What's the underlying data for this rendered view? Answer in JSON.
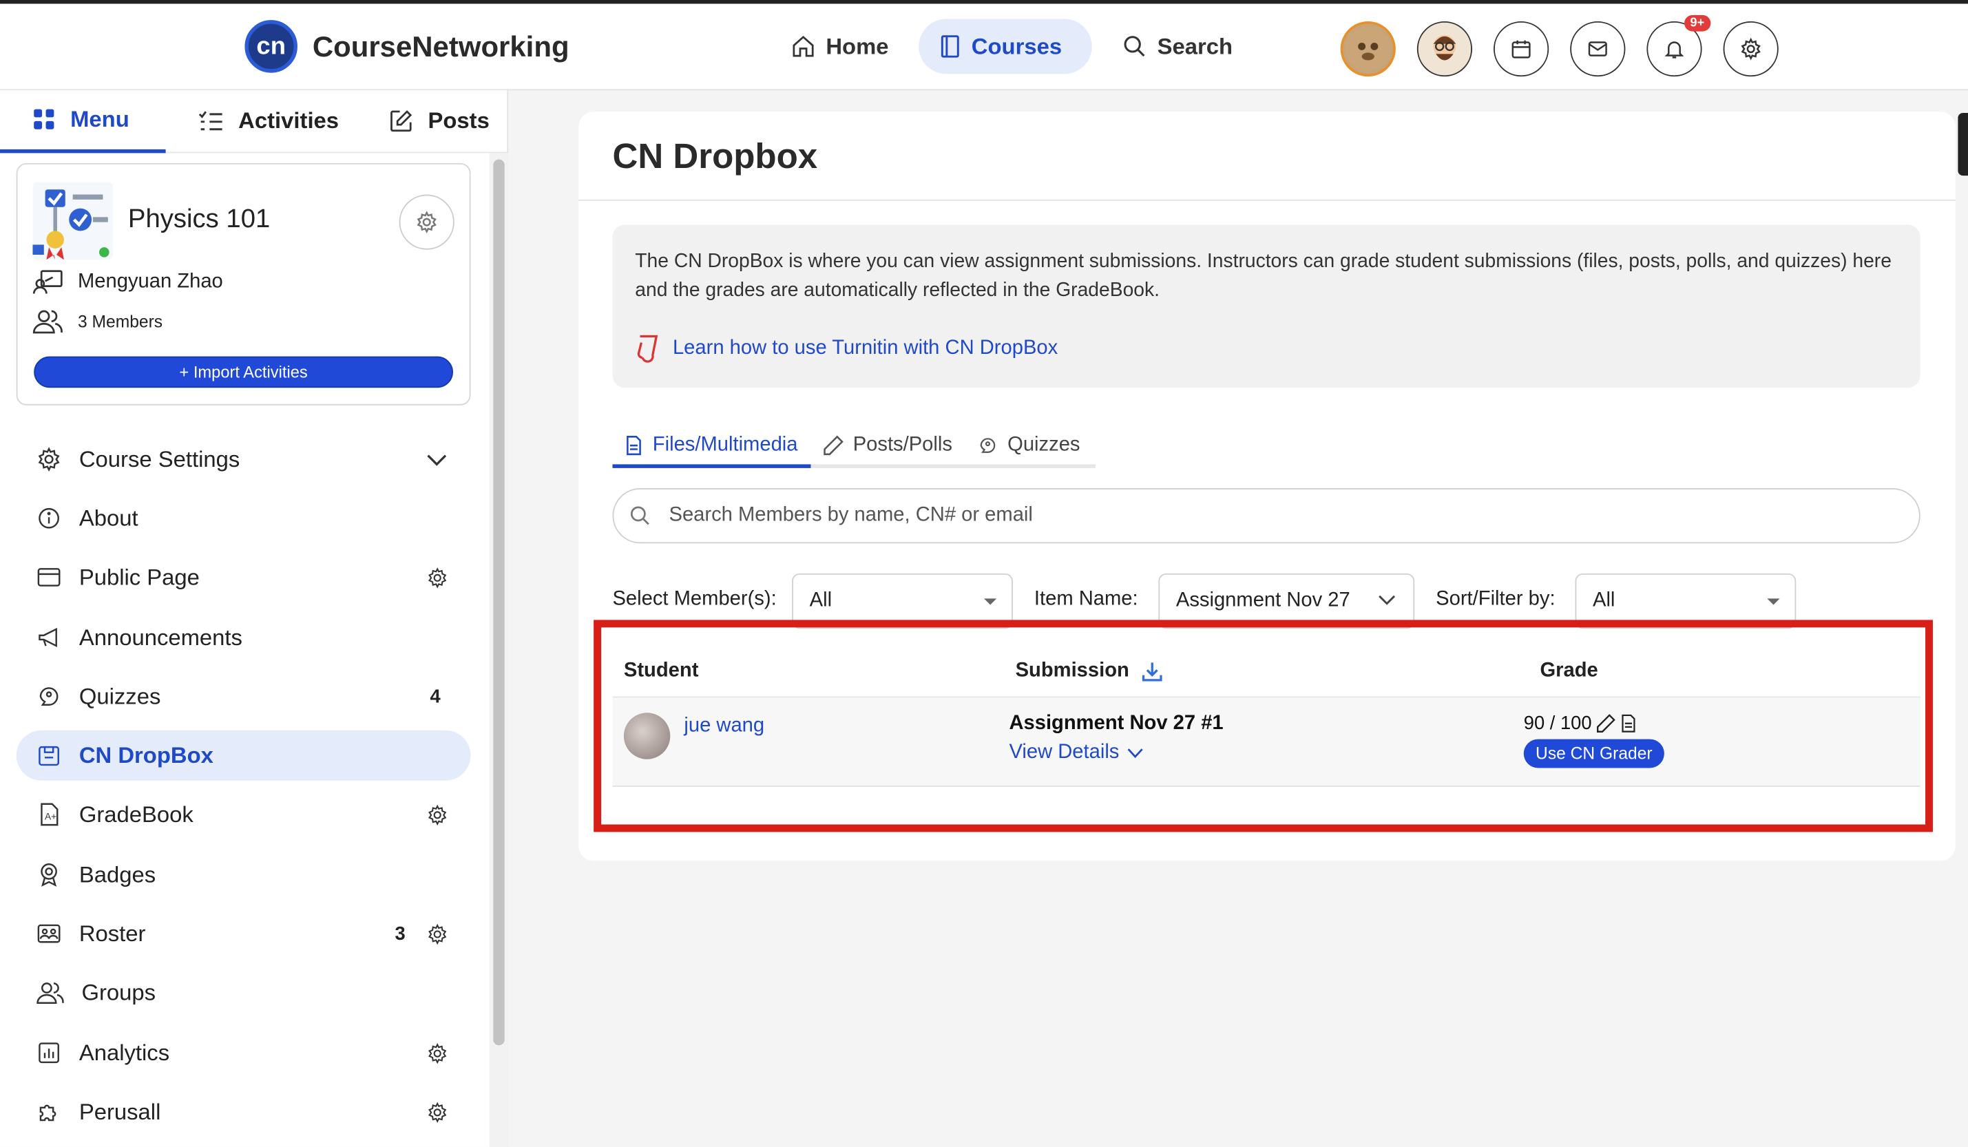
{
  "app": {
    "name": "CourseNetworking",
    "logo_text": "cn"
  },
  "topnav": [
    {
      "label": "Home"
    },
    {
      "label": "Courses"
    },
    {
      "label": "Search"
    }
  ],
  "notifications": {
    "badge": "9+"
  },
  "left_tabs": [
    {
      "label": "Menu"
    },
    {
      "label": "Activities"
    },
    {
      "label": "Posts"
    }
  ],
  "course": {
    "title": "Physics 101",
    "instructor": "Mengyuan Zhao",
    "members": "3 Members",
    "import_button": "+ Import Activities"
  },
  "menu": [
    {
      "label": "Course Settings"
    },
    {
      "label": "About"
    },
    {
      "label": "Public Page"
    },
    {
      "label": "Announcements"
    },
    {
      "label": "Quizzes",
      "count": "4"
    },
    {
      "label": "CN DropBox"
    },
    {
      "label": "GradeBook"
    },
    {
      "label": "Badges"
    },
    {
      "label": "Roster",
      "count": "3"
    },
    {
      "label": "Groups"
    },
    {
      "label": "Analytics"
    },
    {
      "label": "Perusall"
    }
  ],
  "main": {
    "title": "CN Dropbox",
    "info_text": "The CN DropBox is where you can view assignment submissions. Instructors can grade student submissions (files, posts, polls, and quizzes) here and the grades are automatically reflected in the GradeBook.",
    "turnitin_link": "Learn how to use Turnitin with CN DropBox",
    "tabs": [
      {
        "label": "Files/Multimedia"
      },
      {
        "label": "Posts/Polls"
      },
      {
        "label": "Quizzes"
      }
    ],
    "search_placeholder": "Search Members by name, CN# or email",
    "filters": {
      "member_label": "Select Member(s):",
      "member_value": "All",
      "item_label": "Item Name:",
      "item_value": "Assignment Nov 27",
      "sort_label": "Sort/Filter by:",
      "sort_value": "All"
    },
    "table": {
      "headers": {
        "student": "Student",
        "submission": "Submission",
        "grade": "Grade"
      },
      "rows": [
        {
          "student": "jue wang",
          "submission_title": "Assignment Nov 27 #1",
          "view_details": "View Details",
          "grade": "90 / 100",
          "grader_button": "Use CN Grader"
        }
      ]
    }
  },
  "colors": {
    "accent": "#1f49c7",
    "highlight_frame": "#d71f17",
    "button": "#1f49d6"
  }
}
